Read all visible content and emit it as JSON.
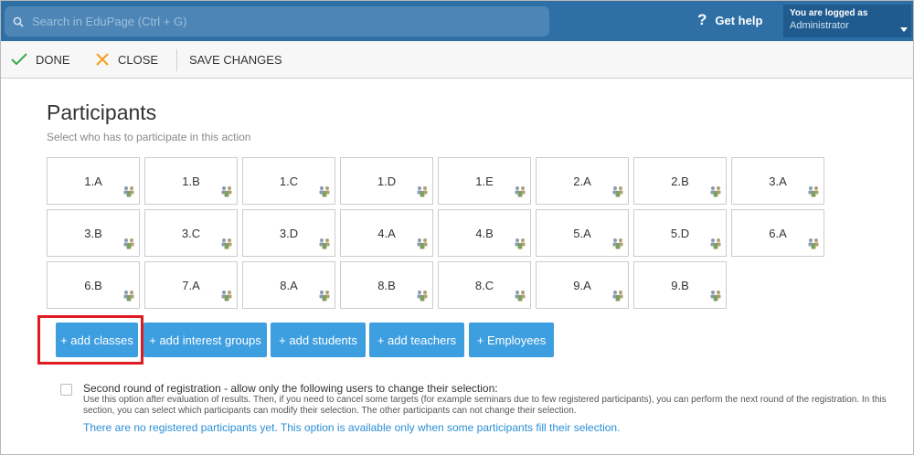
{
  "topbar": {
    "search_placeholder": "Search in EduPage (Ctrl + G)",
    "help_label": "Get help",
    "user_line1": "You are logged as",
    "user_line2": "Administrator",
    "bg_color": "#2e6fa6"
  },
  "toolbar": {
    "done_label": "DONE",
    "close_label": "CLOSE",
    "save_label": "SAVE CHANGES"
  },
  "main": {
    "title": "Participants",
    "subtitle": "Select who has to participate in this action",
    "classes": [
      "1.A",
      "1.B",
      "1.C",
      "1.D",
      "1.E",
      "2.A",
      "2.B",
      "3.A",
      "3.B",
      "3.C",
      "3.D",
      "4.A",
      "4.B",
      "5.A",
      "5.D",
      "6.A",
      "6.B",
      "7.A",
      "8.A",
      "8.B",
      "8.C",
      "9.A",
      "9.B"
    ],
    "buttons": {
      "add_classes": "+ add classes",
      "add_interest_groups": "+ add interest groups",
      "add_students": "+ add students",
      "add_teachers": "+ add teachers",
      "employees": "+ Employees"
    },
    "accent_color": "#3d9ee0",
    "highlight_color": "#e11b22"
  },
  "second_round": {
    "title": "Second round of registration - allow only the following users to change their selection:",
    "description": "Use this option after evaluation of results. Then, if you need to cancel some targets (for example seminars due to few registered participants), you can perform the next round of the registration. In this section, you can select which participants can modify their selection. The other participants can not change their selection.",
    "info": "There are no registered participants yet. This option is available only when some participants fill their selection."
  }
}
